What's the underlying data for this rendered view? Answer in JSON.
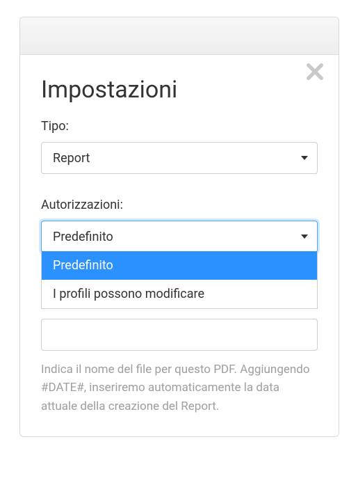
{
  "modal": {
    "title": "Impostazioni",
    "close_icon": "close-icon",
    "tipo": {
      "label": "Tipo:",
      "selected": "Report"
    },
    "autorizzazioni": {
      "label": "Autorizzazioni:",
      "selected": "Predefinito",
      "options": [
        "Predefinito",
        "I profili possono modificare"
      ],
      "highlighted_index": 0
    },
    "filename_input": {
      "value": ""
    },
    "helper_text": "Indica il nome del file per questo PDF. Aggiungendo #DATE#, inseriremo automaticamente la data attuale della creazione del Report."
  },
  "colors": {
    "accent": "#2a91ff",
    "focus_ring": "#4aa3ff",
    "text": "#333333",
    "muted": "#9e9e9e",
    "border": "#cfcfcf"
  }
}
